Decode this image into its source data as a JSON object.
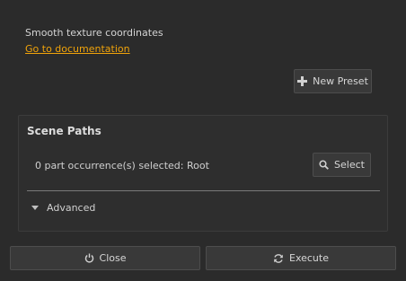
{
  "description": "Smooth texture coordinates",
  "doc_link": "Go to documentation",
  "presets": {
    "new_preset_label": "New Preset",
    "new_preset_icon": "plus-icon"
  },
  "scene_paths": {
    "title": "Scene Paths",
    "selection_text": "0 part occurrence(s) selected: Root",
    "select_label": "Select",
    "select_icon": "search-icon",
    "advanced_label": "Advanced"
  },
  "footer": {
    "close_label": "Close",
    "close_icon": "power-icon",
    "execute_label": "Execute",
    "execute_icon": "refresh-icon"
  },
  "colors": {
    "link": "#f0a30a",
    "background": "#2b2b2b"
  }
}
